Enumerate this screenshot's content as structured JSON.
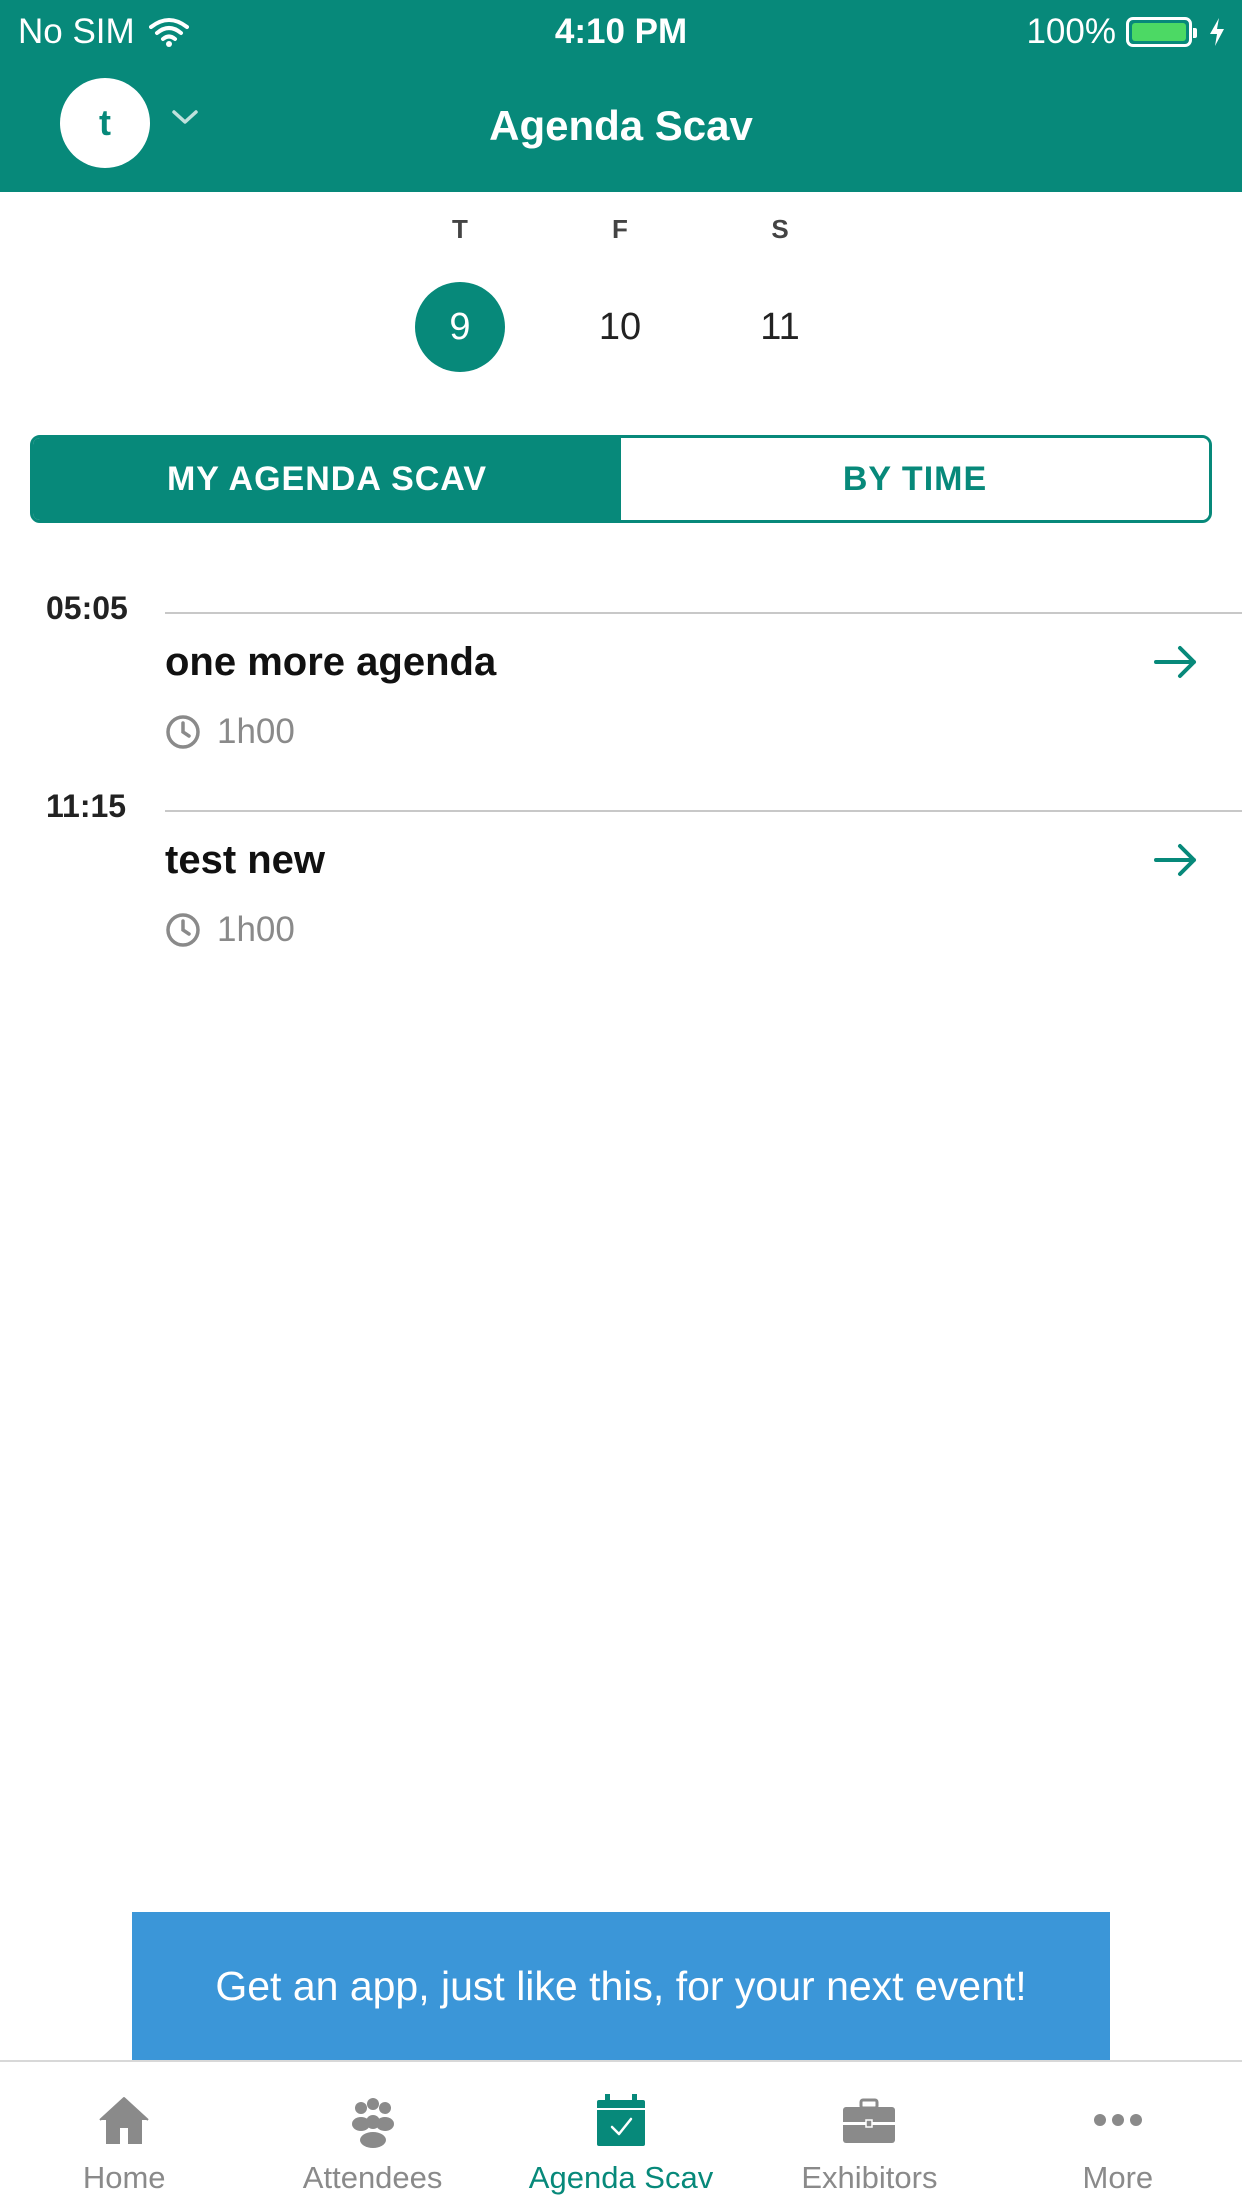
{
  "status_bar": {
    "carrier": "No SIM",
    "time": "4:10 PM",
    "battery": "100%"
  },
  "header": {
    "avatar_letter": "t",
    "title": "Agenda Scav"
  },
  "days": [
    {
      "dow": "T",
      "num": "9",
      "selected": true
    },
    {
      "dow": "F",
      "num": "10",
      "selected": false
    },
    {
      "dow": "S",
      "num": "11",
      "selected": false
    }
  ],
  "segments": {
    "my_agenda": "MY AGENDA SCAV",
    "by_time": "BY TIME",
    "active": "my_agenda"
  },
  "agenda": [
    {
      "time": "05:05",
      "title": "one more agenda",
      "duration": "1h00"
    },
    {
      "time": "11:15",
      "title": "test new",
      "duration": "1h00"
    }
  ],
  "promo": {
    "text": "Get an app, just like this, for your next event!"
  },
  "tabs": [
    {
      "label": "Home",
      "icon": "home-icon",
      "active": false
    },
    {
      "label": "Attendees",
      "icon": "people-icon",
      "active": false
    },
    {
      "label": "Agenda Scav",
      "icon": "calendar-check-icon",
      "active": true
    },
    {
      "label": "Exhibitors",
      "icon": "briefcase-icon",
      "active": false
    },
    {
      "label": "More",
      "icon": "more-dots-icon",
      "active": false
    }
  ],
  "colors": {
    "brand": "#07897a",
    "promo": "#3b96d8",
    "battery": "#4cd964"
  }
}
